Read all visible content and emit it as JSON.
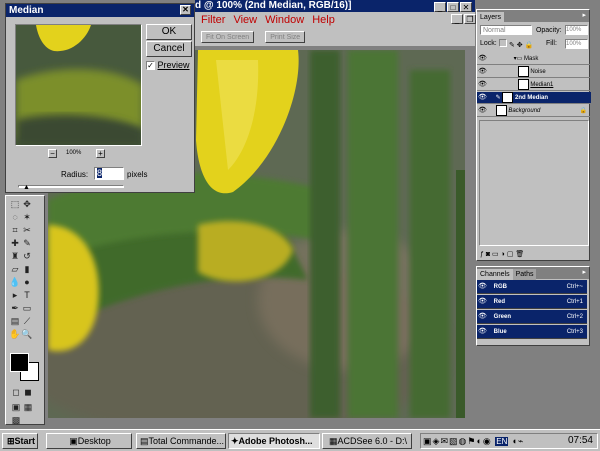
{
  "app": {
    "title": "d @ 100% (2nd Median, RGB/16)]",
    "menu": [
      "Filter",
      "View",
      "Window",
      "Help"
    ],
    "options": [
      "Fit On Screen",
      "Print Size"
    ]
  },
  "dialog": {
    "title": "Median",
    "ok_label": "OK",
    "cancel_label": "Cancel",
    "preview_label": "Preview",
    "preview_checked": true,
    "zoom": "100%",
    "radius_label": "Radius:",
    "radius_value": "8",
    "radius_unit": "pixels"
  },
  "layers": {
    "tabs": [
      "Layers"
    ],
    "blend_mode": "Normal",
    "opacity_label": "Opacity:",
    "opacity_value": "100%",
    "lock_label": "Lock:",
    "fill_label": "Fill:",
    "fill_value": "100%",
    "items": [
      {
        "name": "Mask",
        "selected": false
      },
      {
        "name": "Noise",
        "selected": false
      },
      {
        "name": "Median1",
        "selected": false
      },
      {
        "name": "2nd Median",
        "selected": true
      },
      {
        "name": "Background",
        "selected": false
      }
    ]
  },
  "channels": {
    "tabs": [
      "Channels",
      "Paths"
    ],
    "items": [
      {
        "name": "RGB",
        "shortcut": "Ctrl+~"
      },
      {
        "name": "Red",
        "shortcut": "Ctrl+1"
      },
      {
        "name": "Green",
        "shortcut": "Ctrl+2"
      },
      {
        "name": "Blue",
        "shortcut": "Ctrl+3"
      }
    ]
  },
  "taskbar": {
    "start": "Start",
    "tasks": [
      {
        "label": "Desktop",
        "active": false
      },
      {
        "label": "Total Commande...",
        "active": false
      },
      {
        "label": "Adobe Photosh...",
        "active": true
      },
      {
        "label": "ACDSee 6.0 - D:\\",
        "active": false
      }
    ],
    "tray_lang": "EN",
    "clock": "07:54"
  },
  "colors": {
    "titlebar": "#0a246a",
    "face": "#c0c0c0",
    "menu_text": "#c00000",
    "flower_yellow": "#e3d21c",
    "leaf_green": "#4e7a31"
  }
}
